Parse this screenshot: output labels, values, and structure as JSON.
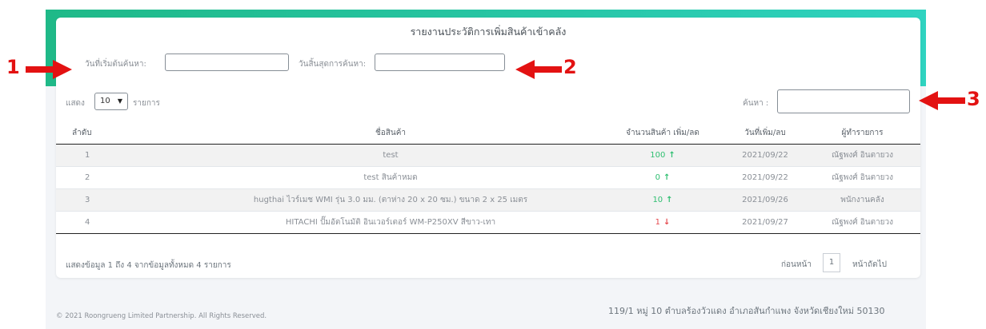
{
  "report": {
    "title": "รายงานประวัติการเพิ่มสินค้าเข้าคลัง",
    "start_date_label": "วันที่เริ่มต้นค้นหา:",
    "start_date_value": "",
    "end_date_label": "วันสิ้นสุดการค้นหา:",
    "end_date_value": "",
    "show_label": "แสดง",
    "page_length": "10",
    "entries_label": "รายการ",
    "search_label": "ค้นหา :",
    "search_value": ""
  },
  "table": {
    "columns": [
      "ลำดับ",
      "ชื่อสินค้า",
      "จำนวนสินค้า เพิ่ม/ลด",
      "วันที่เพิ่ม/ลบ",
      "ผู้ทำรายการ"
    ],
    "rows": [
      {
        "no": "1",
        "name": "test",
        "qty": "100",
        "dir": "up",
        "date": "2021/09/22",
        "user": "ณัฐพงศ์ อินตายวง"
      },
      {
        "no": "2",
        "name": "test สินค้าหมด",
        "qty": "0",
        "dir": "up",
        "date": "2021/09/22",
        "user": "ณัฐพงศ์ อินตายวง"
      },
      {
        "no": "3",
        "name": "hugthai ไวร์เมช WMI รุ่น 3.0 มม. (ตาห่าง 20 x 20 ซม.) ขนาด 2 x 25 เมตร",
        "qty": "10",
        "dir": "up",
        "date": "2021/09/26",
        "user": "พนักงานคลัง"
      },
      {
        "no": "4",
        "name": "HITACHI ปั๊มอัตโนมัติ อินเวอร์เตอร์ WM-P250XV สีขาว-เทา",
        "qty": "1",
        "dir": "down",
        "date": "2021/09/27",
        "user": "ณัฐพงศ์ อินตายวง"
      }
    ],
    "info": "แสดงข้อมูล 1 ถึง 4 จากข้อมูลทั้งหมด 4 รายการ"
  },
  "pagination": {
    "prev": "ก่อนหน้า",
    "current": "1",
    "next": "หน้าถัดไป"
  },
  "footer": {
    "copyright": "© 2021 Roongrueng Limited Partnership. All Rights Reserved.",
    "address": "119/1 หมู่ 10 ตำบลร้องวัวแดง อำเภอสันกำแพง จังหวัดเชียงใหม่ 50130"
  },
  "callouts": [
    "1",
    "2",
    "3"
  ],
  "colors": {
    "accent": "#1fb988",
    "callout": "#e31212",
    "up": "#2fbf71",
    "down": "#e5484d"
  }
}
